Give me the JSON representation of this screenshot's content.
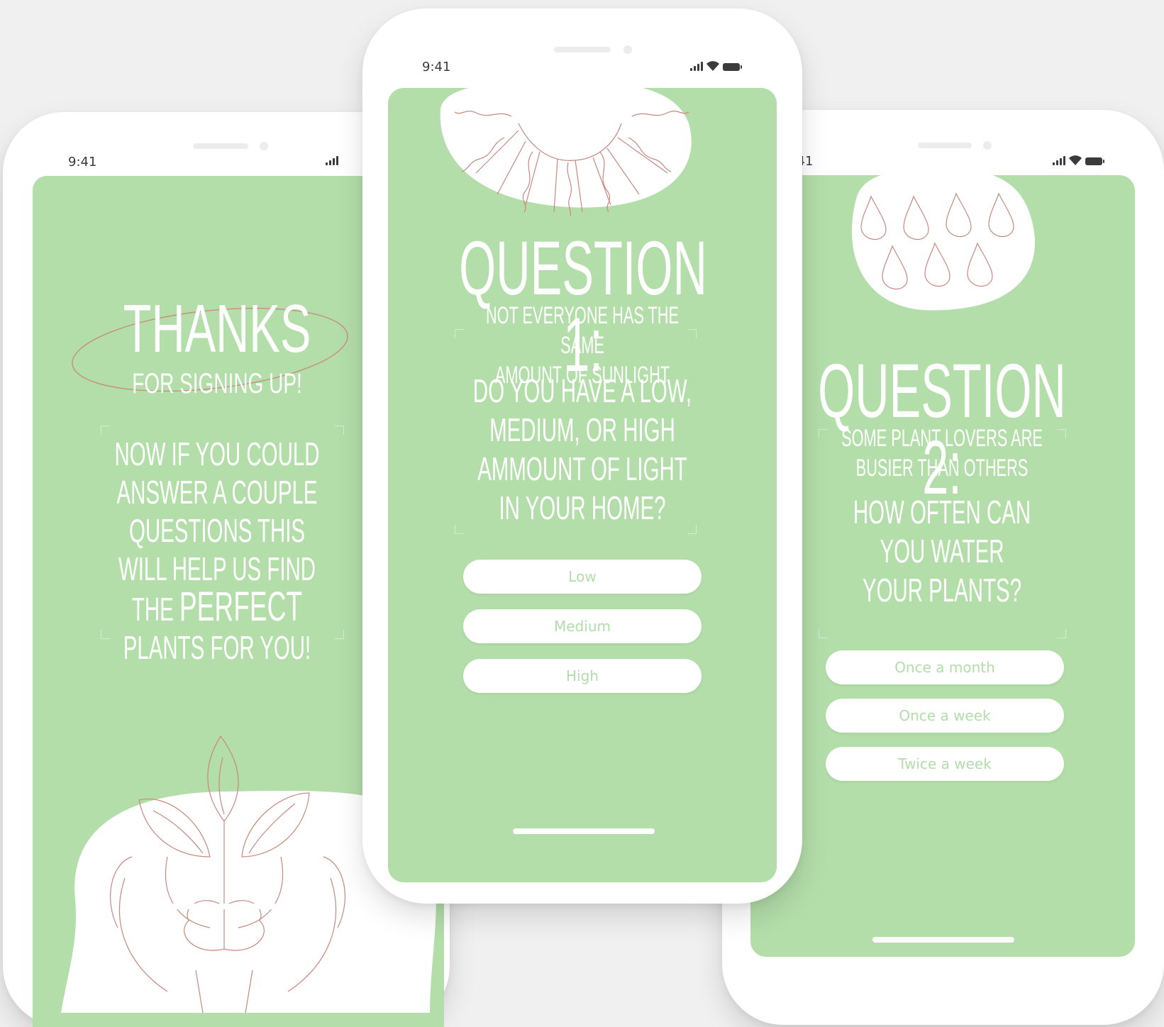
{
  "colors": {
    "screen": "#b3dda9",
    "phone": "#ffffff",
    "background": "#f0f0f0",
    "line_art": "#c8897e"
  },
  "phones": {
    "left": {
      "time": "9:41",
      "title": "THANKS",
      "subtitle": "FOR SIGNING UP!",
      "body_lines": [
        "NOW IF YOU COULD",
        "ANSWER A COUPLE",
        "QUESTIONS THIS",
        "WILL HELP US FIND"
      ],
      "body_the": "THE",
      "body_perfect": "PERFECT",
      "body_last": "PLANTS FOR YOU!",
      "illustration_icon": "hands-holding-plant-icon"
    },
    "middle": {
      "time": "9:41",
      "heading": "QUESTION 1:",
      "intro_lines": [
        "NOT EVERYONE HAS THE SAME",
        "AMOUNT OF SUNLIGHT"
      ],
      "question_lines": [
        "DO YOU HAVE A LOW,",
        "MEDIUM, OR HIGH",
        "AMMOUNT OF LIGHT",
        "IN YOUR HOME?"
      ],
      "options": [
        "Low",
        "Medium",
        "High"
      ],
      "illustration_icon": "sun-icon"
    },
    "right": {
      "time": "9:41",
      "heading": "QUESTION 2:",
      "intro_lines": [
        "SOME PLANT LOVERS ARE",
        "BUSIER THAN OTHERS"
      ],
      "question_lines": [
        "HOW OFTEN CAN",
        "YOU WATER",
        "YOUR PLANTS?"
      ],
      "options": [
        "Once a month",
        "Once a week",
        "Twice a week"
      ],
      "illustration_icon": "water-drops-icon"
    }
  }
}
